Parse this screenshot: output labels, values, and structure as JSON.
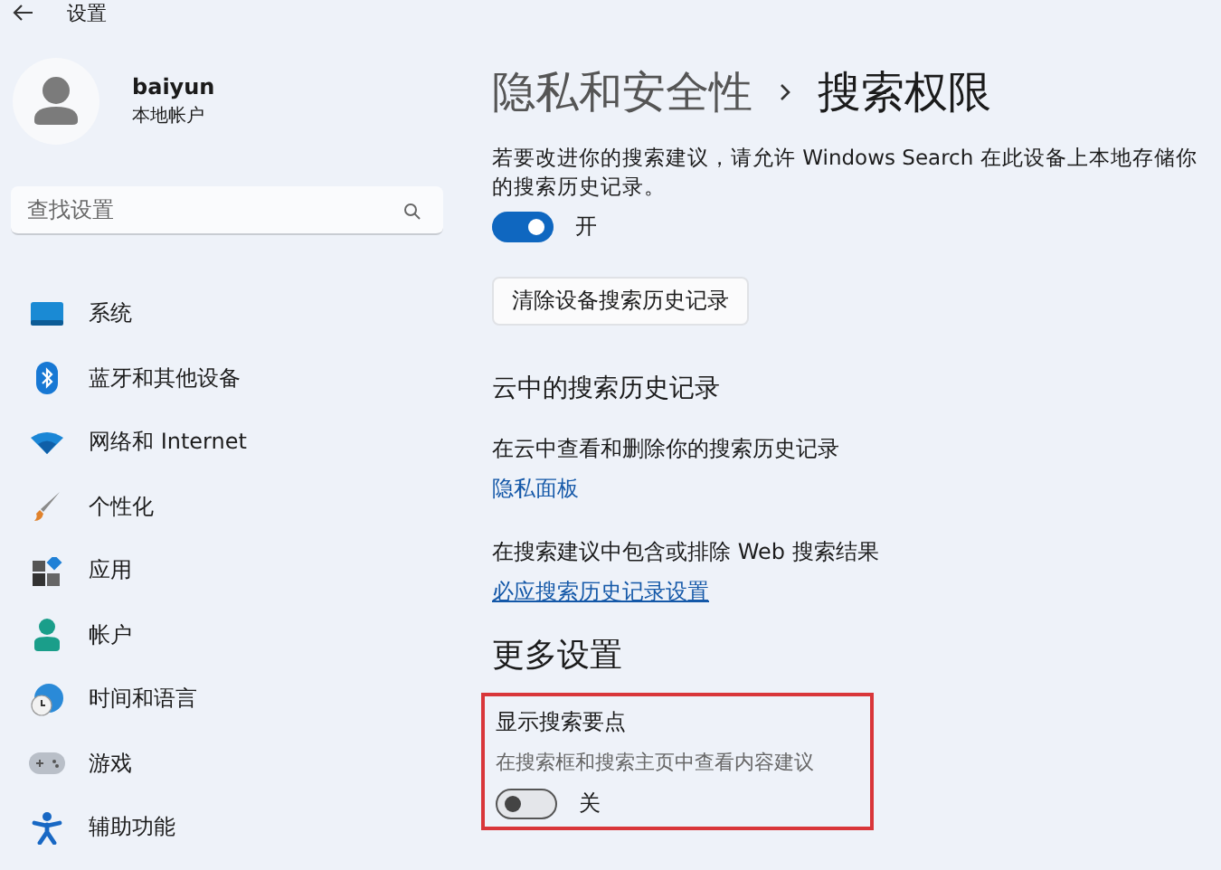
{
  "window": {
    "title": "设置"
  },
  "account": {
    "name": "baiyun",
    "type": "本地帐户"
  },
  "search": {
    "placeholder": "查找设置"
  },
  "nav": [
    {
      "kind": "system",
      "label": "系统"
    },
    {
      "kind": "bluetooth",
      "label": "蓝牙和其他设备"
    },
    {
      "kind": "network",
      "label": "网络和 Internet"
    },
    {
      "kind": "personalize",
      "label": "个性化"
    },
    {
      "kind": "apps",
      "label": "应用"
    },
    {
      "kind": "accounts",
      "label": "帐户"
    },
    {
      "kind": "time",
      "label": "时间和语言"
    },
    {
      "kind": "gaming",
      "label": "游戏"
    },
    {
      "kind": "accessibility",
      "label": "辅助功能"
    }
  ],
  "breadcrumb": {
    "parent": "隐私和安全性",
    "current": "搜索权限"
  },
  "history": {
    "description": "若要改进你的搜索建议，请允许 Windows Search 在此设备上本地存储你的搜索历史记录。",
    "toggle": {
      "on": true,
      "label": "开"
    },
    "clear_button": "清除设备搜索历史记录"
  },
  "cloud": {
    "heading": "云中的搜索历史记录",
    "description": "在云中查看和删除你的搜索历史记录",
    "link": "隐私面板"
  },
  "web": {
    "description": "在搜索建议中包含或排除 Web 搜索结果",
    "link": "必应搜索历史记录设置"
  },
  "more": {
    "heading": "更多设置",
    "setting": {
      "highlighted": true,
      "title": "显示搜索要点",
      "description": "在搜索框和搜索主页中查看内容建议",
      "toggle": {
        "on": false,
        "label": "关"
      }
    }
  }
}
